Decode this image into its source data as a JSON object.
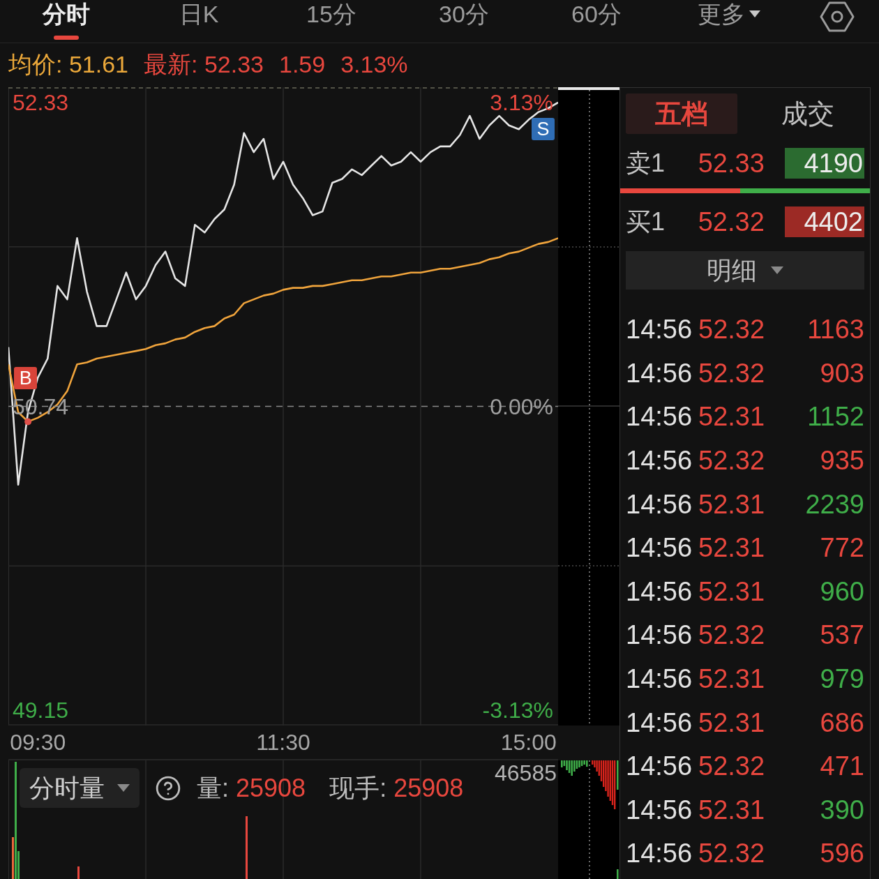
{
  "top_tabs": [
    {
      "label": "分时",
      "selected": true,
      "kind": "tab"
    },
    {
      "label": "日K",
      "selected": false,
      "kind": "tab"
    },
    {
      "label": "15分",
      "selected": false,
      "kind": "tab"
    },
    {
      "label": "30分",
      "selected": false,
      "kind": "tab"
    },
    {
      "label": "60分",
      "selected": false,
      "kind": "tab"
    },
    {
      "label": "更多",
      "selected": false,
      "kind": "menu"
    }
  ],
  "quote_bar": [
    {
      "kind": "average",
      "text": "均价: 51.61"
    },
    {
      "kind": "latest",
      "text": "最新: 52.33"
    },
    {
      "kind": "change",
      "text": "1.59"
    },
    {
      "kind": "change_pct",
      "text": "3.13%"
    }
  ],
  "price_chart": {
    "percent_labels": [
      {
        "text": "3.13%",
        "color": "#e8473e"
      },
      {
        "text": "0.00%",
        "color": "#a0a0a0"
      },
      {
        "text": "-3.13%",
        "color": "#3fae49"
      }
    ],
    "trade_markers": [
      {
        "kind": "buy",
        "text": "B"
      },
      {
        "kind": "sell",
        "text": "S"
      }
    ],
    "chart_data": {
      "type": "line",
      "grid": true,
      "categories": [
        null,
        null,
        null,
        "09:30",
        null,
        null,
        null,
        null,
        null,
        null,
        null,
        null,
        null,
        null,
        null,
        null,
        null,
        null,
        null,
        null,
        null,
        null,
        null,
        null,
        null,
        null,
        null,
        null,
        "11:30",
        null,
        null,
        null,
        null,
        null,
        null,
        null,
        null,
        null,
        null,
        null,
        null,
        null,
        null,
        null,
        null,
        null,
        null,
        null,
        null,
        null,
        null,
        null,
        null,
        "15:00",
        null,
        null,
        null
      ],
      "series": [
        {
          "color": "#e6e6e6",
          "values": [
            51.05,
            50.33,
            50.71,
            50.89,
            50.99,
            51.37,
            51.3,
            51.62,
            51.34,
            51.16,
            51.16,
            51.3,
            51.44,
            51.3,
            51.37,
            51.48,
            51.55,
            51.41,
            51.37,
            51.69,
            51.65,
            51.72,
            51.77,
            51.9,
            52.17,
            52.07,
            52.14,
            51.93,
            52.02,
            51.9,
            51.83,
            51.74,
            51.76,
            51.91,
            51.93,
            51.98,
            51.95,
            52.0,
            52.05,
            52.0,
            52.02,
            52.07,
            52.02,
            52.07,
            52.1,
            52.1,
            52.16,
            52.26,
            52.14,
            52.21,
            52.26,
            52.21,
            52.19,
            52.24,
            52.28,
            52.3,
            52.33
          ]
        },
        {
          "color": "#f0a43c",
          "values": [
            50.96,
            50.71,
            50.66,
            50.68,
            50.71,
            50.75,
            50.82,
            50.96,
            50.97,
            50.99,
            51.0,
            51.01,
            51.02,
            51.03,
            51.04,
            51.06,
            51.07,
            51.09,
            51.1,
            51.13,
            51.15,
            51.16,
            51.2,
            51.22,
            51.28,
            51.3,
            51.32,
            51.33,
            51.35,
            51.36,
            51.36,
            51.37,
            51.37,
            51.38,
            51.39,
            51.4,
            51.4,
            51.41,
            51.42,
            51.42,
            51.43,
            51.44,
            51.44,
            51.45,
            51.46,
            51.46,
            51.47,
            51.48,
            51.49,
            51.51,
            51.52,
            51.54,
            51.55,
            51.57,
            51.59,
            51.6,
            51.62
          ]
        }
      ],
      "ylim": [
        49.07,
        52.41
      ],
      "yticks": [
        {
          "value": 52.33,
          "label": "52.33"
        },
        {
          "value": 50.74,
          "label": "50.74"
        },
        {
          "value": 49.15,
          "label": "49.15"
        }
      ],
      "ref_lines": [
        {
          "axis": "y",
          "value": 50.74
        }
      ]
    }
  },
  "volume_panel": {
    "selector": "分时量",
    "stats": [
      {
        "label": "量:",
        "value": "25908"
      },
      {
        "label": "现手:",
        "value": "25908"
      }
    ],
    "max_label": "46585"
  },
  "order_panel": {
    "tabs": [
      {
        "label": "五档",
        "selected": true
      },
      {
        "label": "成交",
        "selected": false
      }
    ],
    "ask": {
      "label": "卖1",
      "price": "52.33",
      "volume": "4190"
    },
    "ratio_bar": {
      "level": 0.48
    },
    "bid": {
      "label": "买1",
      "price": "52.32",
      "volume": "4402"
    },
    "detail_button": "明细",
    "trades": [
      {
        "time": "14:56",
        "price": "52.32",
        "volume": "1163",
        "color": "#e8473e"
      },
      {
        "time": "14:56",
        "price": "52.32",
        "volume": "903",
        "color": "#e8473e"
      },
      {
        "time": "14:56",
        "price": "52.31",
        "volume": "1152",
        "color": "#3fae49"
      },
      {
        "time": "14:56",
        "price": "52.32",
        "volume": "935",
        "color": "#e8473e"
      },
      {
        "time": "14:56",
        "price": "52.31",
        "volume": "2239",
        "color": "#3fae49"
      },
      {
        "time": "14:56",
        "price": "52.31",
        "volume": "772",
        "color": "#e8473e"
      },
      {
        "time": "14:56",
        "price": "52.31",
        "volume": "960",
        "color": "#3fae49"
      },
      {
        "time": "14:56",
        "price": "52.32",
        "volume": "537",
        "color": "#e8473e"
      },
      {
        "time": "14:56",
        "price": "52.31",
        "volume": "979",
        "color": "#3fae49"
      },
      {
        "time": "14:56",
        "price": "52.31",
        "volume": "686",
        "color": "#e8473e"
      },
      {
        "time": "14:56",
        "price": "52.32",
        "volume": "471",
        "color": "#e8473e"
      },
      {
        "time": "14:56",
        "price": "52.31",
        "volume": "390",
        "color": "#3fae49"
      },
      {
        "time": "14:56",
        "price": "52.32",
        "volume": "596",
        "color": "#e8473e"
      }
    ]
  }
}
